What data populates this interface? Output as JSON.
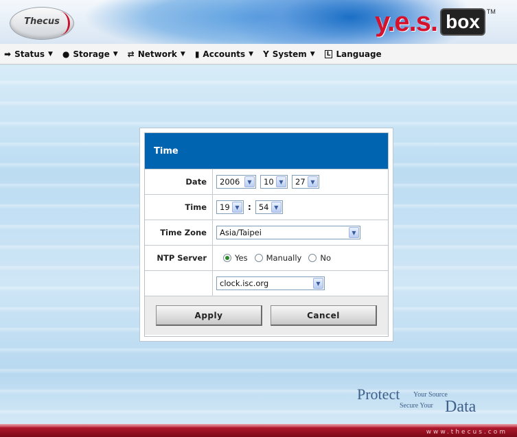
{
  "header": {
    "logo_text": "Thecus",
    "brand_text": "y.e.s.",
    "brand_box": "box",
    "brand_tm": "TM"
  },
  "menu": [
    {
      "label": "Status",
      "icon": "status-icon",
      "glyph": "➡"
    },
    {
      "label": "Storage",
      "icon": "storage-icon",
      "glyph": "●"
    },
    {
      "label": "Network",
      "icon": "network-icon",
      "glyph": "⇄"
    },
    {
      "label": "Accounts",
      "icon": "accounts-icon",
      "glyph": "▮"
    },
    {
      "label": "System",
      "icon": "system-icon",
      "glyph": "Y"
    },
    {
      "label": "Language",
      "icon": "language-icon",
      "glyph": "L"
    }
  ],
  "dialog": {
    "title": "Time",
    "date_label": "Date",
    "date_year": "2006",
    "date_month": "10",
    "date_day": "27",
    "time_label": "Time",
    "time_hour": "19",
    "time_colon": ":",
    "time_minute": "54",
    "timezone_label": "Time Zone",
    "timezone_value": "Asia/Taipei",
    "ntp_label": "NTP Server",
    "ntp_options": [
      "Yes",
      "Manually",
      "No"
    ],
    "ntp_selected": "Yes",
    "ntp_server_value": "clock.isc.org",
    "apply_label": "Apply",
    "cancel_label": "Cancel"
  },
  "footer": {
    "slogan_protect": "Protect",
    "slogan_your_source": "Your Source",
    "slogan_secure_your": "Secure Your",
    "slogan_data": "Data",
    "url": "www.thecus.com"
  },
  "colors": {
    "title_bar": "#0064b0",
    "brand_red": "#d4122e",
    "footer_red": "#a01226"
  }
}
